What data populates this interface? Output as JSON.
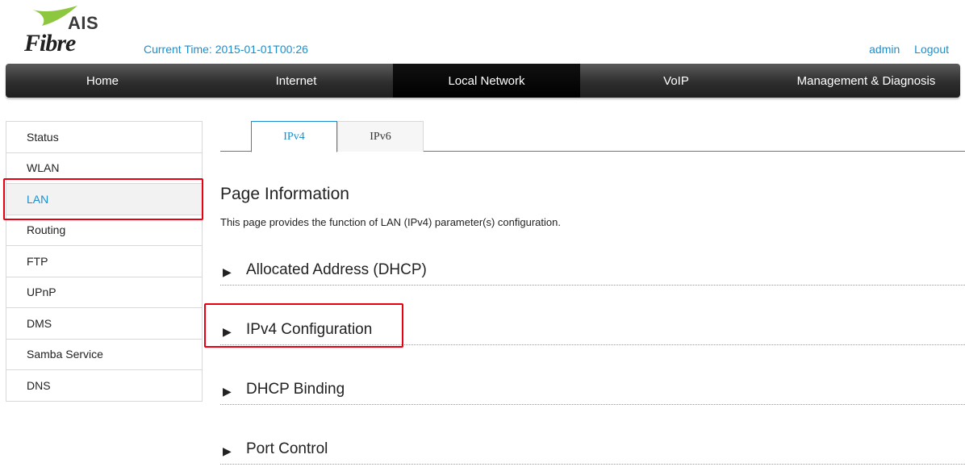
{
  "header": {
    "logo": {
      "brand": "AIS",
      "product": "Fibre"
    },
    "current_time": "Current Time: 2015-01-01T00:26",
    "user": {
      "admin_label": "admin",
      "logout_label": "Logout"
    }
  },
  "navbar": {
    "items": [
      {
        "label": "Home"
      },
      {
        "label": "Internet"
      },
      {
        "label": "Local Network"
      },
      {
        "label": "VoIP"
      },
      {
        "label": "Management & Diagnosis"
      }
    ],
    "active": "Local Network"
  },
  "sidebar": {
    "items": [
      {
        "label": "Status"
      },
      {
        "label": "WLAN"
      },
      {
        "label": "LAN"
      },
      {
        "label": "Routing"
      },
      {
        "label": "FTP"
      },
      {
        "label": "UPnP"
      },
      {
        "label": "DMS"
      },
      {
        "label": "Samba Service"
      },
      {
        "label": "DNS"
      }
    ],
    "active": "LAN"
  },
  "tabs": [
    {
      "label": "IPv4"
    },
    {
      "label": "IPv6"
    }
  ],
  "main": {
    "title": "Page Information",
    "description": "This page provides the function of LAN (IPv4) parameter(s) configuration.",
    "sections": [
      {
        "label": "Allocated Address (DHCP)"
      },
      {
        "label": "IPv4 Configuration"
      },
      {
        "label": "DHCP Binding"
      },
      {
        "label": "Port Control"
      }
    ]
  },
  "colors": {
    "accent": "#1a8fcf",
    "highlight": "#e60012",
    "navbar": "#2e2e2e",
    "logo_swoosh": "#8dc63f"
  },
  "icons": {
    "section_arrow": "triangle-right-icon"
  }
}
